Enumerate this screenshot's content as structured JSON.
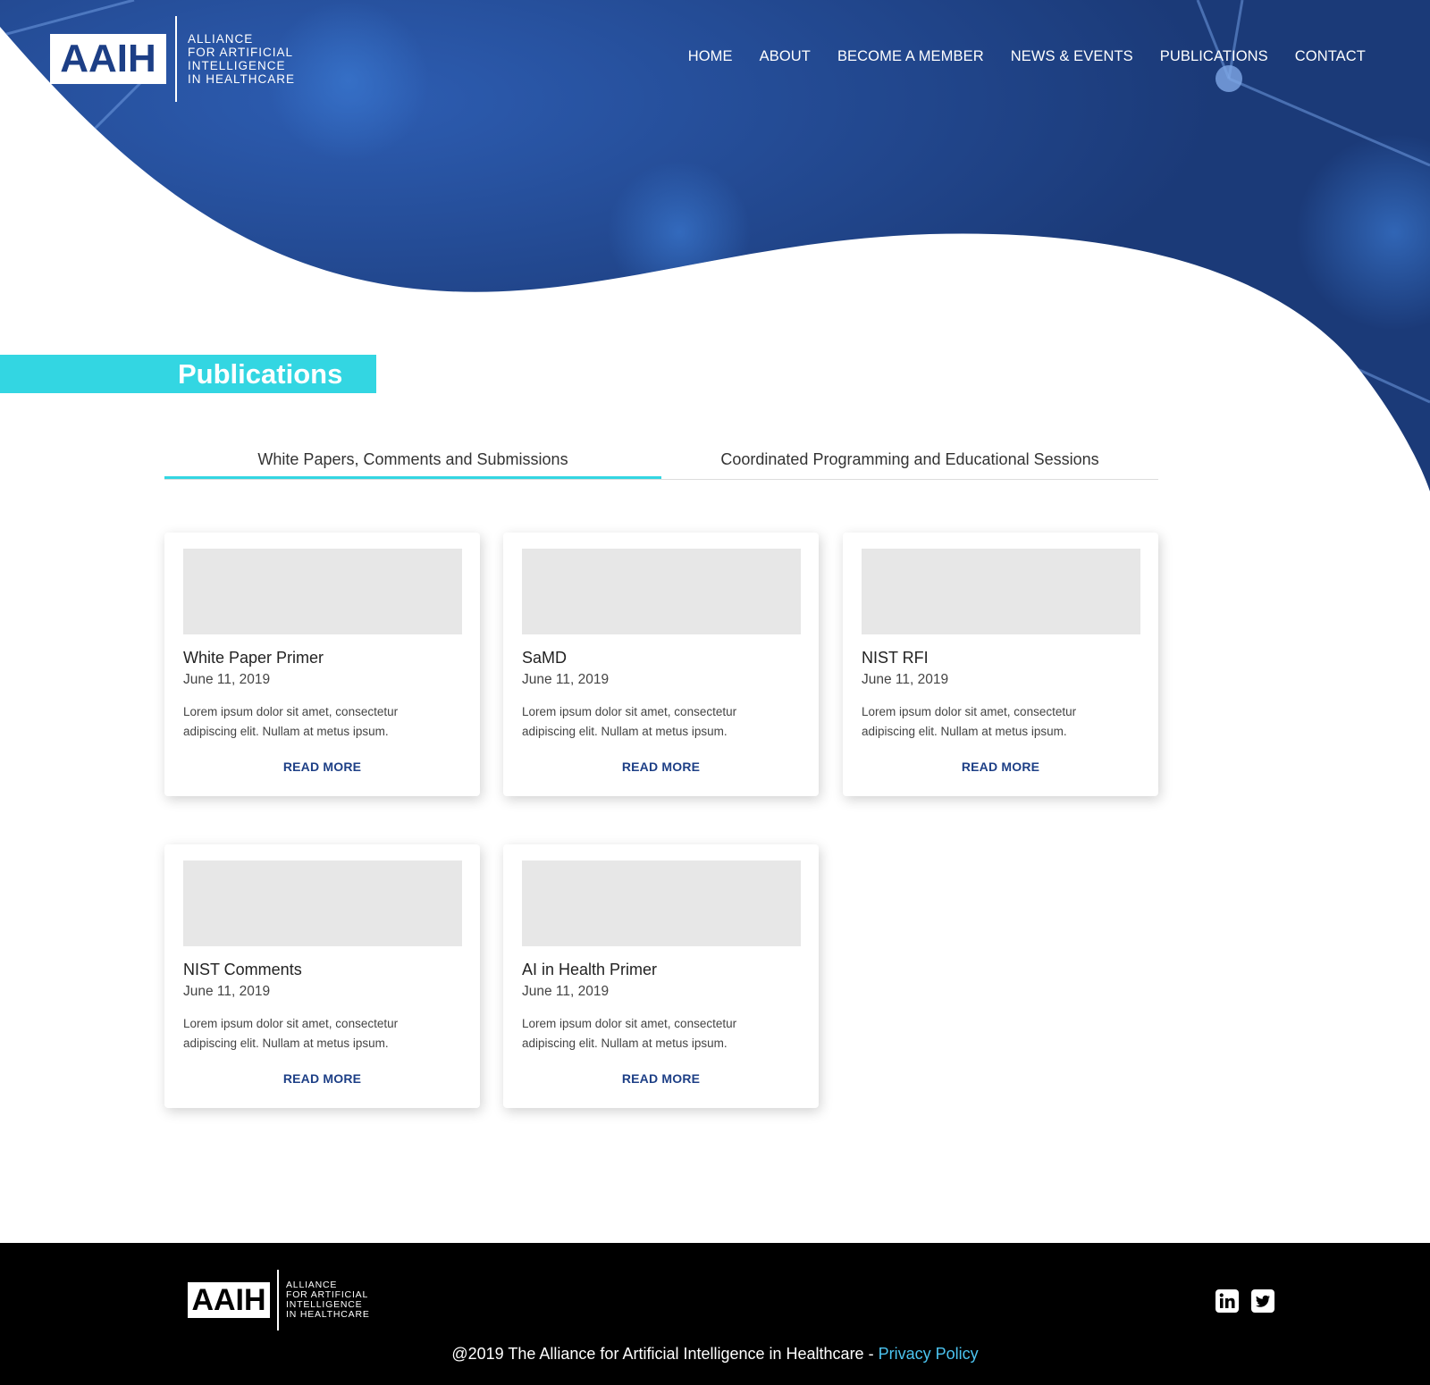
{
  "brand": {
    "abbr": "AAIH",
    "name_lines": [
      "ALLIANCE",
      "FOR ARTIFICIAL",
      "INTELLIGENCE",
      "IN HEALTHCARE"
    ]
  },
  "nav": {
    "items": [
      "HOME",
      "ABOUT",
      "BECOME A MEMBER",
      "NEWS & EVENTS",
      "PUBLICATIONS",
      "CONTACT"
    ]
  },
  "page": {
    "title": "Publications"
  },
  "tabs": [
    {
      "label": "White Papers, Comments and Submissions",
      "active": true
    },
    {
      "label": "Coordinated Programming and Educational Sessions",
      "active": false
    }
  ],
  "cards": [
    {
      "title": "White Paper Primer",
      "date": "June 11, 2019",
      "desc": "Lorem ipsum dolor sit amet, consectetur adipiscing elit. Nullam at metus ipsum.",
      "cta": "READ MORE"
    },
    {
      "title": "SaMD",
      "date": "June 11, 2019",
      "desc": "Lorem ipsum dolor sit amet, consectetur adipiscing elit. Nullam at metus ipsum.",
      "cta": "READ MORE"
    },
    {
      "title": "NIST RFI",
      "date": "June 11, 2019",
      "desc": "Lorem ipsum dolor sit amet, consectetur adipiscing elit. Nullam at metus ipsum.",
      "cta": "READ MORE"
    },
    {
      "title": "NIST Comments",
      "date": "June 11, 2019",
      "desc": "Lorem ipsum dolor sit amet, consectetur adipiscing elit. Nullam at metus ipsum.",
      "cta": "READ MORE"
    },
    {
      "title": "AI in Health Primer",
      "date": "June 11, 2019",
      "desc": "Lorem ipsum dolor sit amet, consectetur adipiscing elit. Nullam at metus ipsum.",
      "cta": "READ MORE"
    }
  ],
  "footer": {
    "copyright": "@2019 The Alliance for Artificial Intelligence in Healthcare - ",
    "privacy_link": "Privacy Policy",
    "social": [
      "linkedin-icon",
      "twitter-icon"
    ]
  },
  "colors": {
    "accent": "#33d6e2",
    "brand_blue": "#1d3f86",
    "hero_blue": "#1f3f7f",
    "footer_bg": "#000000",
    "link": "#4cc4f0"
  }
}
